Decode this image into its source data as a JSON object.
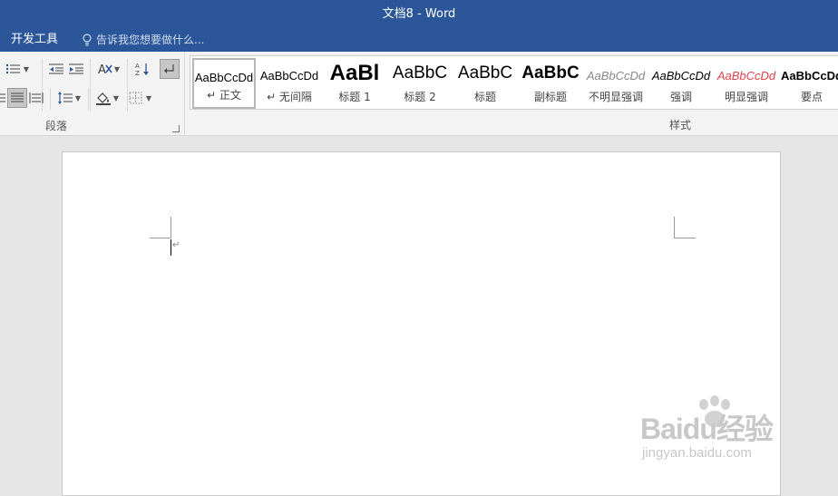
{
  "title_bar": {
    "title": "文档8 - Word"
  },
  "tell_bar": {
    "tab_label": "开发工具",
    "tell_me_placeholder": "告诉我您想要做什么..."
  },
  "ribbon": {
    "paragraph_group_label": "段落",
    "styles_group_label": "样式",
    "styles": [
      {
        "sample": "AaBbCcDd",
        "label": "↵ 正文",
        "selected": true
      },
      {
        "sample": "AaBbCcDd",
        "label": "↵ 无间隔"
      },
      {
        "sample": "AaBl",
        "label": "标题 1"
      },
      {
        "sample": "AaBbC",
        "label": "标题 2"
      },
      {
        "sample": "AaBbC",
        "label": "标题"
      },
      {
        "sample": "AaBbC",
        "label": "副标题"
      },
      {
        "sample": "AaBbCcDd",
        "label": "不明显强调"
      },
      {
        "sample": "AaBbCcDd",
        "label": "强调"
      },
      {
        "sample": "AaBbCcDd",
        "label": "明显强调"
      },
      {
        "sample": "AaBbCcDd",
        "label": "要点"
      }
    ]
  },
  "document": {
    "paragraph_mark": "↵"
  },
  "watermark": {
    "main": "Baidu经验",
    "sub": "jingyan.baidu.com"
  },
  "colors": {
    "title_bar": "#2b579a",
    "ribbon_bg": "#f3f3f3",
    "canvas_bg": "#e6e6e6",
    "emphasis_red": "#e0424a"
  }
}
